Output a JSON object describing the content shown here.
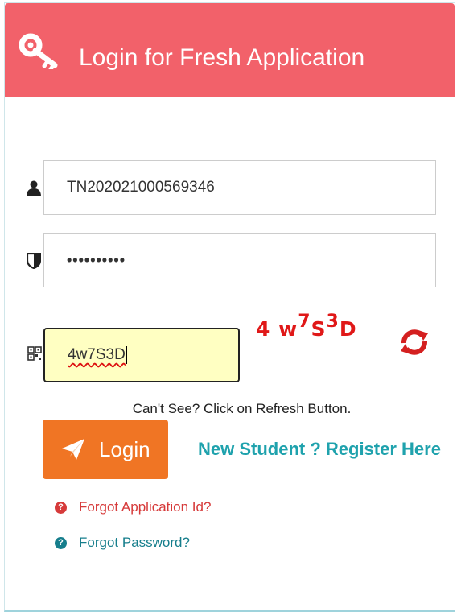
{
  "header": {
    "icon": "key-icon",
    "title": "Login for Fresh Application",
    "color": "#f2616a"
  },
  "form": {
    "application_id": {
      "icon": "user-icon",
      "value": "TN202021000569346"
    },
    "password": {
      "icon": "shield-icon",
      "value": "••••••••••"
    },
    "captcha_input": {
      "icon": "qr-code-icon",
      "value": "4w7S3D"
    },
    "captcha_image": {
      "part1": "4 w",
      "sup1": "7",
      "part2": "S",
      "sup2": "3",
      "part3": "D"
    },
    "refresh_icon": "refresh-icon",
    "help_text": "Can't See? Click on Refresh Button."
  },
  "actions": {
    "login_label": "Login",
    "login_icon": "paper-plane-icon",
    "register_label": "New Student ? Register Here",
    "forgot_app_id": "Forgot Application Id?",
    "forgot_password": "Forgot Password?"
  },
  "colors": {
    "login_button": "#f07524",
    "register_link": "#1fa2ad",
    "forgot_app": "#d63a3a",
    "forgot_password": "#167e8c",
    "captcha_text": "#e01818"
  }
}
